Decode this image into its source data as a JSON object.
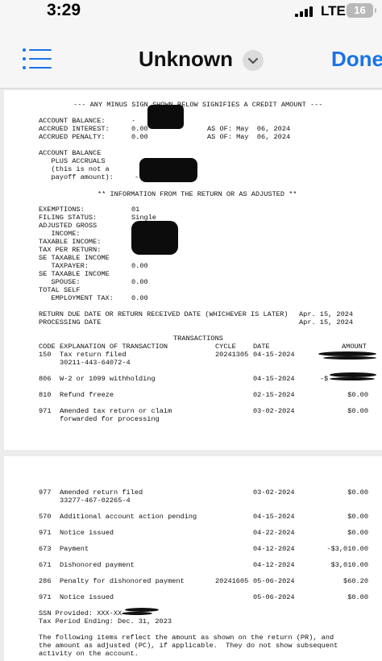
{
  "status_bar": {
    "time": "3:29",
    "network": "LTE",
    "battery": "16"
  },
  "nav": {
    "title": "Unknown",
    "done_label": "Done"
  },
  "page1": {
    "header_note": "--- ANY MINUS SIGN SHOWN BELOW SIGNIFIES A CREDIT AMOUNT ---",
    "account_balance_label": "ACCOUNT BALANCE:",
    "account_balance_value": "-",
    "accrued_interest_label": "ACCRUED INTEREST:",
    "accrued_interest_value": "0.00",
    "accrued_interest_asof": "AS OF: May  06, 2024",
    "accrued_penalty_label": "ACCRUED PENALTY:",
    "accrued_penalty_value": "0.00",
    "accrued_penalty_asof": "AS OF: May  06, 2024",
    "balance_plus_accruals": [
      "ACCOUNT BALANCE",
      "   PLUS ACCRUALS",
      "   (this is not a",
      "   payoff amount):"
    ],
    "balance_plus_accruals_value": "-",
    "info_header": "** INFORMATION FROM THE RETURN OR AS ADJUSTED **",
    "fields": [
      {
        "label": "EXEMPTIONS:",
        "value": "01"
      },
      {
        "label": "FILING STATUS:",
        "value": "Single"
      },
      {
        "label": "ADJUSTED GROSS",
        "value": ""
      },
      {
        "label": "   INCOME:",
        "value": ""
      },
      {
        "label": "TAXABLE INCOME:",
        "value": ""
      },
      {
        "label": "TAX PER RETURN:",
        "value": ""
      },
      {
        "label": "SE TAXABLE INCOME",
        "value": ""
      },
      {
        "label": "   TAXPAYER:",
        "value": "0.00"
      },
      {
        "label": "SE TAXABLE INCOME",
        "value": ""
      },
      {
        "label": "   SPOUSE:",
        "value": "0.00"
      },
      {
        "label": "TOTAL SELF",
        "value": ""
      },
      {
        "label": "   EMPLOYMENT TAX:",
        "value": "0.00"
      }
    ],
    "return_due_label": "RETURN DUE DATE OR RETURN RECEIVED DATE (WHICHEVER IS LATER)",
    "return_due_value": "Apr. 15, 2024",
    "processing_label": "PROCESSING DATE",
    "processing_value": "Apr. 15, 2024",
    "transactions_title": "TRANSACTIONS",
    "columns": {
      "code": "CODE",
      "explanation": "EXPLANATION OF TRANSACTION",
      "cycle": "CYCLE",
      "date": "DATE",
      "amount": "AMOUNT"
    },
    "transactions": [
      {
        "code": "150",
        "lines": [
          "Tax return filed",
          "30211-443-64072-4"
        ],
        "cycle": "20241305",
        "date": "04-15-2024",
        "amount": ""
      },
      {
        "code": "806",
        "lines": [
          "W-2 or 1099 withholding"
        ],
        "cycle": "",
        "date": "04-15-2024",
        "amount": "-$"
      },
      {
        "code": "810",
        "lines": [
          "Refund freeze"
        ],
        "cycle": "",
        "date": "02-15-2024",
        "amount": "$0.00"
      },
      {
        "code": "971",
        "lines": [
          "Amended tax return or claim",
          "forwarded for processing"
        ],
        "cycle": "",
        "date": "03-02-2024",
        "amount": "$0.00"
      }
    ]
  },
  "page2": {
    "transactions": [
      {
        "code": "977",
        "lines": [
          "Amended return filed",
          "33277-467-02265-4"
        ],
        "cycle": "",
        "date": "03-02-2024",
        "amount": "$0.00"
      },
      {
        "code": "570",
        "lines": [
          "Additional account action pending"
        ],
        "cycle": "",
        "date": "04-15-2024",
        "amount": "$0.00"
      },
      {
        "code": "971",
        "lines": [
          "Notice issued"
        ],
        "cycle": "",
        "date": "04-22-2024",
        "amount": "$0.00"
      },
      {
        "code": "673",
        "lines": [
          "Payment"
        ],
        "cycle": "",
        "date": "04-12-2024",
        "amount": "-$3,010.00"
      },
      {
        "code": "671",
        "lines": [
          "Dishonored payment"
        ],
        "cycle": "",
        "date": "04-12-2024",
        "amount": "$3,010.00"
      },
      {
        "code": "286",
        "lines": [
          "Penalty for dishonored payment"
        ],
        "cycle": "20241605",
        "date": "05-06-2024",
        "amount": "$60.20"
      },
      {
        "code": "971",
        "lines": [
          "Notice issued"
        ],
        "cycle": "",
        "date": "05-06-2024",
        "amount": "$0.00"
      }
    ],
    "ssn_label": "SSN Provided: XXX-XX-",
    "tax_period": "Tax Period Ending: Dec. 31, 2023",
    "footer_lines": [
      "The following items reflect the amount as shown on the return (PR), and",
      "the amount as adjusted (PC), if applicable.  They do not show subsequent",
      "activity on the account."
    ]
  }
}
